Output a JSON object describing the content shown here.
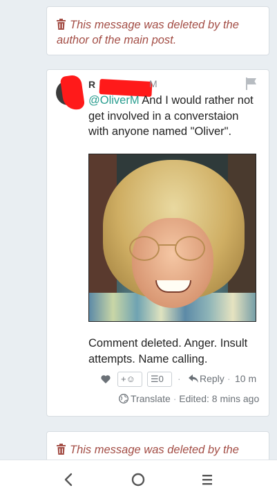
{
  "deleted_top": {
    "text": "This message was deleted by the author of the main post."
  },
  "post": {
    "author_visible": "R",
    "author_suffix": "M",
    "mention": "@OliverM",
    "message": " And I would rather not get involved in a converstaion with anyone named \"Oliver\".",
    "caption": "Comment deleted. Anger. Insult attempts. Name calling.",
    "react_add_label": "+☺",
    "react_count": "0",
    "reply_label": "Reply",
    "time": "10 m",
    "translate_label": "Translate",
    "edited": "Edited: 8 mins ago"
  },
  "deleted_bottom": {
    "text": "This message was deleted by the author of the main post."
  },
  "colors": {
    "deleted": "#a34d45",
    "mention": "#2a9d8f",
    "redaction": "#ff1a1a"
  },
  "icons": [
    "trash-icon",
    "flag-icon",
    "heart-icon",
    "reply-icon",
    "globe-icon",
    "back-icon",
    "home-icon",
    "menu-icon"
  ]
}
